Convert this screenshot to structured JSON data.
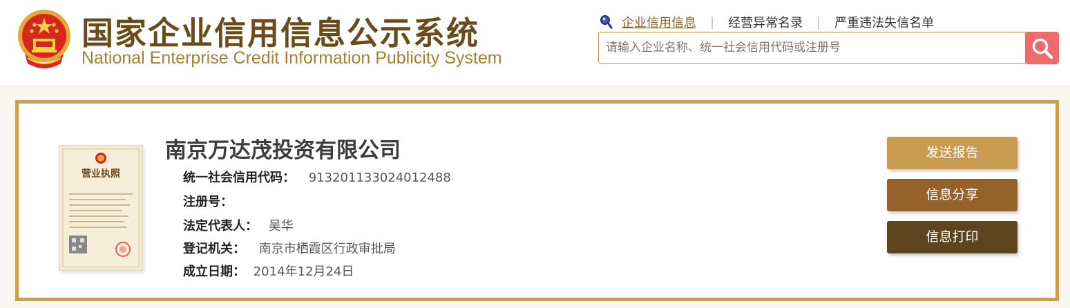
{
  "site": {
    "title": "国家企业信用信息公示系统",
    "subtitle": "National Enterprise Credit Information Publicity System"
  },
  "nav": {
    "items": [
      "企业信用信息",
      "经营异常名录",
      "严重违法失信名单"
    ],
    "active": "企业信用信息"
  },
  "search": {
    "placeholder": "请输入企业名称、统一社会信用代码或注册号",
    "value": ""
  },
  "company": {
    "name": "南京万达茂投资有限公司",
    "fields": [
      {
        "label": "统一社会信用代码：",
        "value": "913201133024012488"
      },
      {
        "label": "注册号：",
        "value": ""
      },
      {
        "label": "法定代表人：",
        "value": "吴华"
      },
      {
        "label": "登记机关：",
        "value": "南京市栖霞区行政审批局"
      },
      {
        "label": "成立日期：",
        "value": "2014年12月24日"
      }
    ]
  },
  "license": {
    "title": "营业执照"
  },
  "actions": {
    "send_report": "发送报告",
    "share": "信息分享",
    "print": "信息打印"
  },
  "colors": {
    "title_brown": "#6b4b1a",
    "subtitle_gold": "#a67f33",
    "card_border": "#cf9f4a",
    "search_button": "#ef6b6b",
    "btn_send": "#c99b50",
    "btn_share": "#94622a",
    "btn_print": "#5e4520"
  }
}
